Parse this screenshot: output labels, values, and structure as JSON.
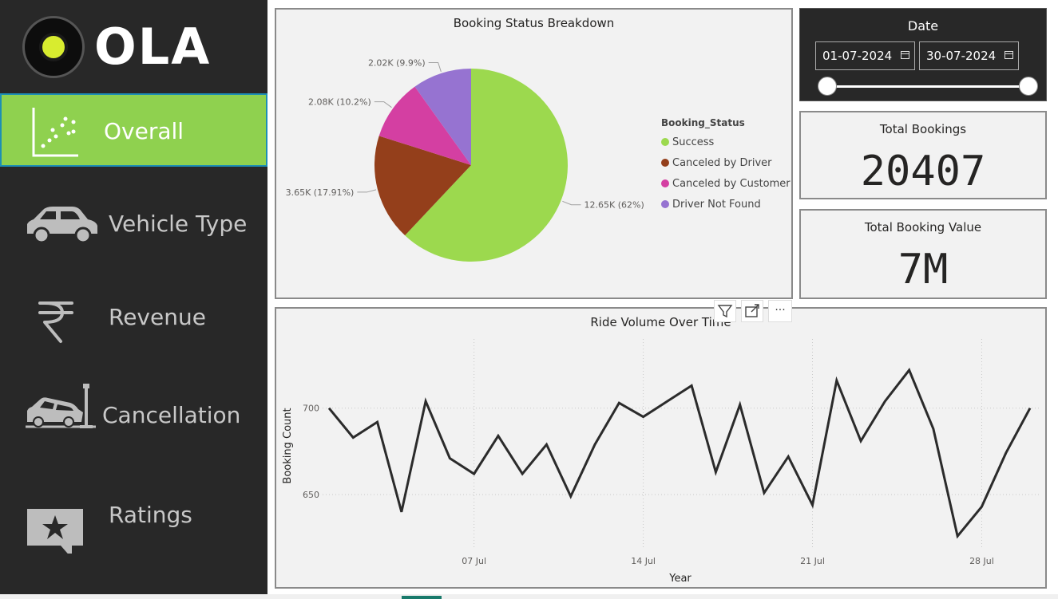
{
  "brand": {
    "name": "OLA"
  },
  "nav": {
    "items": [
      {
        "label": "Overall",
        "icon": "scatter-chart-icon"
      },
      {
        "label": "Vehicle Type",
        "icon": "car-icon"
      },
      {
        "label": "Revenue",
        "icon": "rupee-icon"
      },
      {
        "label": "Cancellation",
        "icon": "car-crash-icon"
      },
      {
        "label": "Ratings",
        "icon": "star-comment-icon"
      }
    ]
  },
  "date_filter": {
    "title": "Date",
    "start": "01-07-2024",
    "end": "30-07-2024",
    "start_icon": "calendar-icon",
    "end_icon": "calendar-icon"
  },
  "kpis": {
    "total_bookings": {
      "label": "Total Bookings",
      "value": "20407"
    },
    "total_booking_value": {
      "label": "Total Booking Value",
      "value": "7M"
    }
  },
  "colors": {
    "accent": "#8fd14f",
    "sidebar": "#282828",
    "success": "#9cd94e",
    "canceled_driver": "#943f1b",
    "canceled_customer": "#d43fa2",
    "driver_not_found": "#9673d1",
    "line": "#2b2b2b"
  },
  "chart_data": [
    {
      "type": "pie",
      "title": "Booking Status Breakdown",
      "legend_title": "Booking_Status",
      "legend_position": "right",
      "slices": [
        {
          "name": "Success",
          "value": 12650,
          "label": "12.65K (62%)",
          "percent": 62
        },
        {
          "name": "Canceled by Driver",
          "value": 3650,
          "label": "3.65K (17.91%)",
          "percent": 17.91
        },
        {
          "name": "Canceled by Customer",
          "value": 2080,
          "label": "2.08K (10.2%)",
          "percent": 10.2
        },
        {
          "name": "Driver Not Found",
          "value": 2020,
          "label": "2.02K (9.9%)",
          "percent": 9.9
        }
      ]
    },
    {
      "type": "line",
      "title": "Ride Volume Over Time",
      "xlabel": "Year",
      "ylabel": "Booking Count",
      "x_ticks": [
        "07 Jul",
        "14 Jul",
        "21 Jul",
        "28 Jul"
      ],
      "y_ticks": [
        650,
        700
      ],
      "ylim": [
        621,
        740
      ],
      "grid": true,
      "x": [
        "2024-07-01",
        "2024-07-02",
        "2024-07-03",
        "2024-07-04",
        "2024-07-05",
        "2024-07-06",
        "2024-07-07",
        "2024-07-08",
        "2024-07-09",
        "2024-07-10",
        "2024-07-11",
        "2024-07-12",
        "2024-07-13",
        "2024-07-14",
        "2024-07-15",
        "2024-07-16",
        "2024-07-17",
        "2024-07-18",
        "2024-07-19",
        "2024-07-20",
        "2024-07-21",
        "2024-07-22",
        "2024-07-23",
        "2024-07-24",
        "2024-07-25",
        "2024-07-26",
        "2024-07-27",
        "2024-07-28",
        "2024-07-29",
        "2024-07-30"
      ],
      "values": [
        700,
        683,
        692,
        640,
        704,
        671,
        662,
        684,
        662,
        679,
        649,
        679,
        703,
        695,
        704,
        713,
        663,
        702,
        651,
        672,
        644,
        716,
        681,
        704,
        722,
        688,
        626,
        643,
        674,
        700
      ]
    }
  ],
  "visual_toolbar": {
    "filter_icon": "filter-icon",
    "focus_icon": "focus-mode-icon",
    "more_icon": "more-options-icon",
    "more_label": "···"
  }
}
